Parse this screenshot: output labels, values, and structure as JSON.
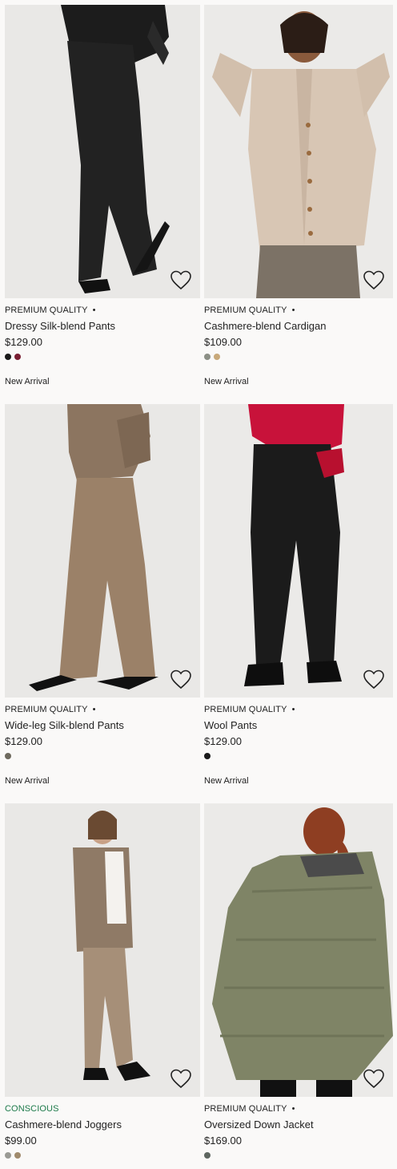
{
  "products": [
    {
      "tag": "PREMIUM QUALITY",
      "tag_dot": "•",
      "title": "Dressy Silk-blend Pants",
      "price": "$129.00",
      "swatches": [
        "#1a1a1a",
        "#7a1f33"
      ],
      "badge": "New Arrival",
      "favorite_icon": "heart-outline-icon"
    },
    {
      "tag": "PREMIUM QUALITY",
      "tag_dot": "•",
      "title": "Cashmere-blend Cardigan",
      "price": "$109.00",
      "swatches": [
        "#8b8f85",
        "#c8a97a"
      ],
      "badge": "New Arrival",
      "favorite_icon": "heart-outline-icon"
    },
    {
      "tag": "PREMIUM QUALITY",
      "tag_dot": "•",
      "title": "Wide-leg Silk-blend Pants",
      "price": "$129.00",
      "swatches": [
        "#6e6a5e"
      ],
      "badge": "New Arrival",
      "favorite_icon": "heart-outline-icon"
    },
    {
      "tag": "PREMIUM QUALITY",
      "tag_dot": "•",
      "title": "Wool Pants",
      "price": "$129.00",
      "swatches": [
        "#1a1a1a"
      ],
      "badge": "New Arrival",
      "favorite_icon": "heart-outline-icon"
    },
    {
      "tag": "CONSCIOUS",
      "tag_dot": "",
      "title": "Cashmere-blend Joggers",
      "price": "$99.00",
      "swatches": [
        "#9a9a94",
        "#a08a6c"
      ],
      "badge": "",
      "favorite_icon": "heart-outline-icon"
    },
    {
      "tag": "PREMIUM QUALITY",
      "tag_dot": "•",
      "title": "Oversized Down Jacket",
      "price": "$169.00",
      "swatches": [
        "#5e6660"
      ],
      "badge": "",
      "favorite_icon": "heart-outline-icon"
    }
  ]
}
